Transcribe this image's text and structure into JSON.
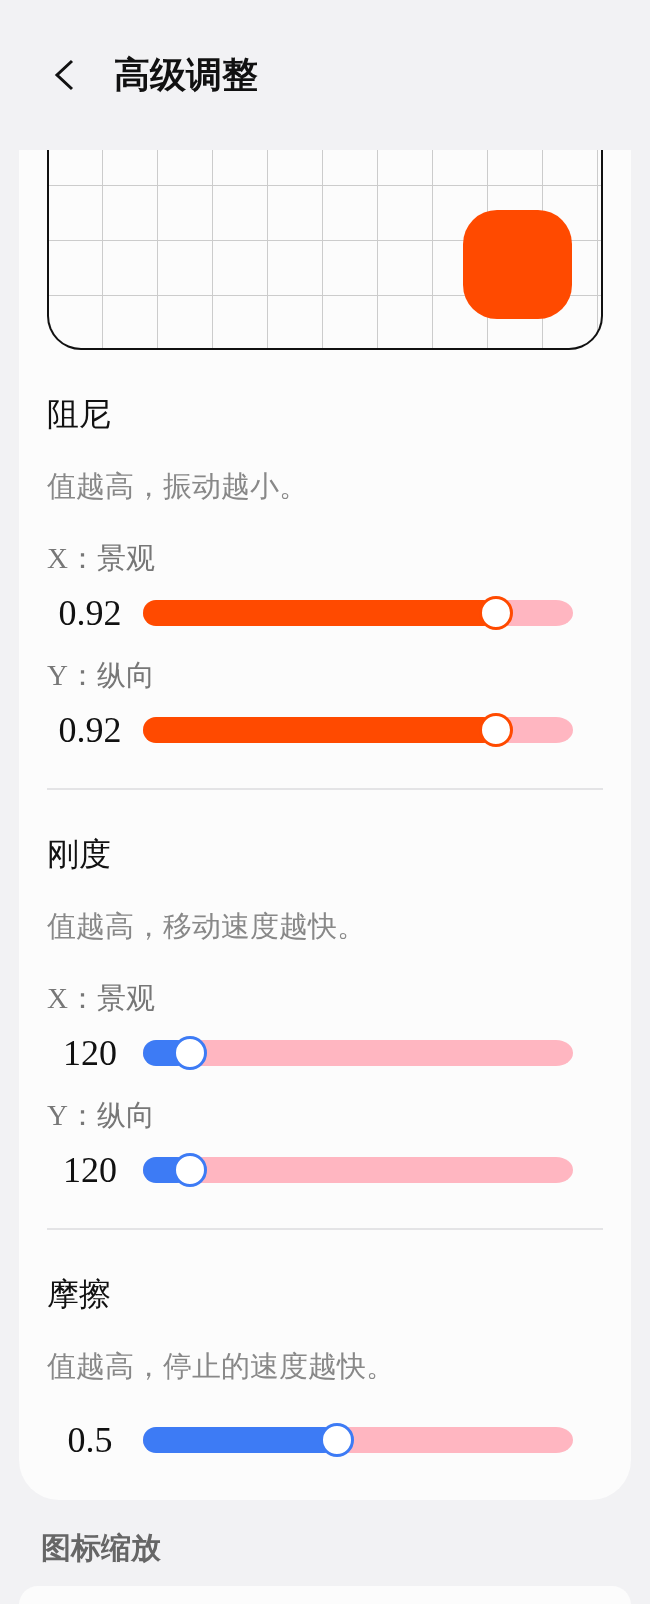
{
  "header": {
    "title": "高级调整"
  },
  "sections": [
    {
      "title": "阻尼",
      "description": "值越高，振动越小。",
      "sliders": [
        {
          "label": "X：景观",
          "value": "0.92",
          "level": 0.82,
          "color": "#ff4a00"
        },
        {
          "label": "Y：纵向",
          "value": "0.92",
          "level": 0.82,
          "color": "#ff4a00"
        }
      ]
    },
    {
      "title": "刚度",
      "description": "值越高，移动速度越快。",
      "sliders": [
        {
          "label": "X：景观",
          "value": "120",
          "level": 0.11,
          "color": "#3d7bf5"
        },
        {
          "label": "Y：纵向",
          "value": "120",
          "level": 0.11,
          "color": "#3d7bf5"
        }
      ]
    },
    {
      "title": "摩擦",
      "description": "值越高，停止的速度越快。",
      "sliders": [
        {
          "value": "0.5",
          "level": 0.45,
          "color": "#3d7bf5"
        }
      ]
    }
  ],
  "next_section": {
    "title": "图标缩放"
  }
}
